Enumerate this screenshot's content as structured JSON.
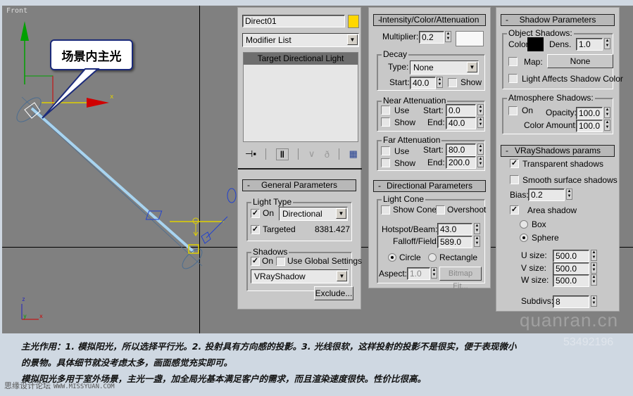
{
  "viewport": {
    "label": "Front",
    "callout": "场景内主光",
    "axis_x": "x",
    "tripod": {
      "z": "z",
      "y": "y",
      "x": "x"
    }
  },
  "modify_panel": {
    "object_name": "Direct01",
    "object_color": "#ffd700",
    "modifier_list": "Modifier List",
    "stack_items": [
      "Target Directional Light"
    ],
    "stack_icons": [
      "pin-stack-icon",
      "show-end-result-icon",
      "make-unique-icon",
      "remove-modifier-icon",
      "configure-modifier-sets-icon"
    ]
  },
  "general_parameters": {
    "title": "General Parameters",
    "light_type": {
      "label": "Light Type",
      "on_label": "On",
      "on": true,
      "type": "Directional",
      "targeted_label": "Targeted",
      "targeted": true,
      "target_distance": "8381.427"
    },
    "shadows": {
      "label": "Shadows",
      "on_label": "On",
      "on": true,
      "use_global_label": "Use Global Settings",
      "use_global": false,
      "type": "VRayShadow"
    },
    "exclude_label": "Exclude..."
  },
  "intensity": {
    "title": "Intensity/Color/Attenuation",
    "multiplier_label": "Multiplier:",
    "multiplier": "0.2",
    "color": "#f8f8f8",
    "decay": {
      "label": "Decay",
      "type_label": "Type:",
      "type": "None",
      "start_label": "Start:",
      "start": "40.0",
      "show_label": "Show",
      "show": false
    },
    "near": {
      "label": "Near Attenuation",
      "use_label": "Use",
      "show_label": "Show",
      "start_label": "Start:",
      "start": "0.0",
      "end_label": "End:",
      "end": "40.0"
    },
    "far": {
      "label": "Far Attenuation",
      "use_label": "Use",
      "show_label": "Show",
      "start_label": "Start:",
      "start": "80.0",
      "end_label": "End:",
      "end": "200.0"
    }
  },
  "directional": {
    "title": "Directional Parameters",
    "cone_label": "Light Cone",
    "show_cone_label": "Show Cone",
    "overshoot_label": "Overshoot",
    "hotspot_label": "Hotspot/Beam:",
    "hotspot": "43.0",
    "falloff_label": "Falloff/Field:",
    "falloff": "589.0",
    "circle_label": "Circle",
    "rectangle_label": "Rectangle",
    "shape": "Circle",
    "aspect_label": "Aspect:",
    "aspect": "1.0",
    "bitmap_fit_label": "Bitmap Fit..."
  },
  "shadow_params": {
    "title": "Shadow Parameters",
    "object_shadows": {
      "label": "Object Shadows:",
      "color_label": "Color:",
      "color": "#000000",
      "dens_label": "Dens.",
      "dens": "1.0",
      "map_label": "Map:",
      "map_value": "None",
      "light_affects_label": "Light Affects Shadow Color"
    },
    "atmosphere": {
      "label": "Atmosphere Shadows:",
      "on_label": "On",
      "opacity_label": "Opacity:",
      "opacity": "100.0",
      "color_amount_label": "Color Amount:",
      "color_amount": "100.0"
    }
  },
  "vray_shadows": {
    "title": "VRayShadows params",
    "transparent_label": "Transparent shadows",
    "transparent": true,
    "smooth_label": "Smooth surface shadows",
    "smooth": false,
    "bias_label": "Bias:",
    "bias": "0.2",
    "area_label": "Area shadow",
    "area": true,
    "box_label": "Box",
    "sphere_label": "Sphere",
    "shape": "Sphere",
    "u_label": "U size:",
    "u": "500.0",
    "v_label": "V size:",
    "v": "500.0",
    "w_label": "W size:",
    "w": "500.0",
    "subdivs_label": "Subdivs:",
    "subdivs": "8"
  },
  "caption": {
    "line1": "主光作用：1. 模拟阳光，所以选择平行光。2. 投射具有方向感的投影。3. 光线很软，这样投射的投影不是很实，便于表现微小",
    "line2": "的景物。具体细节就没考虑太多，画面感觉充实即可。",
    "line3": "模拟阳光多用于室外场景，主光一盏，加全局光基本满足客户的需求，而且渲染速度很快。性价比很高。"
  },
  "watermarks": {
    "site_cn": "思缘设计论坛",
    "site_url": "WWW.MISSYUAN.COM",
    "brand": "quanran.cn",
    "number": "53492196"
  }
}
